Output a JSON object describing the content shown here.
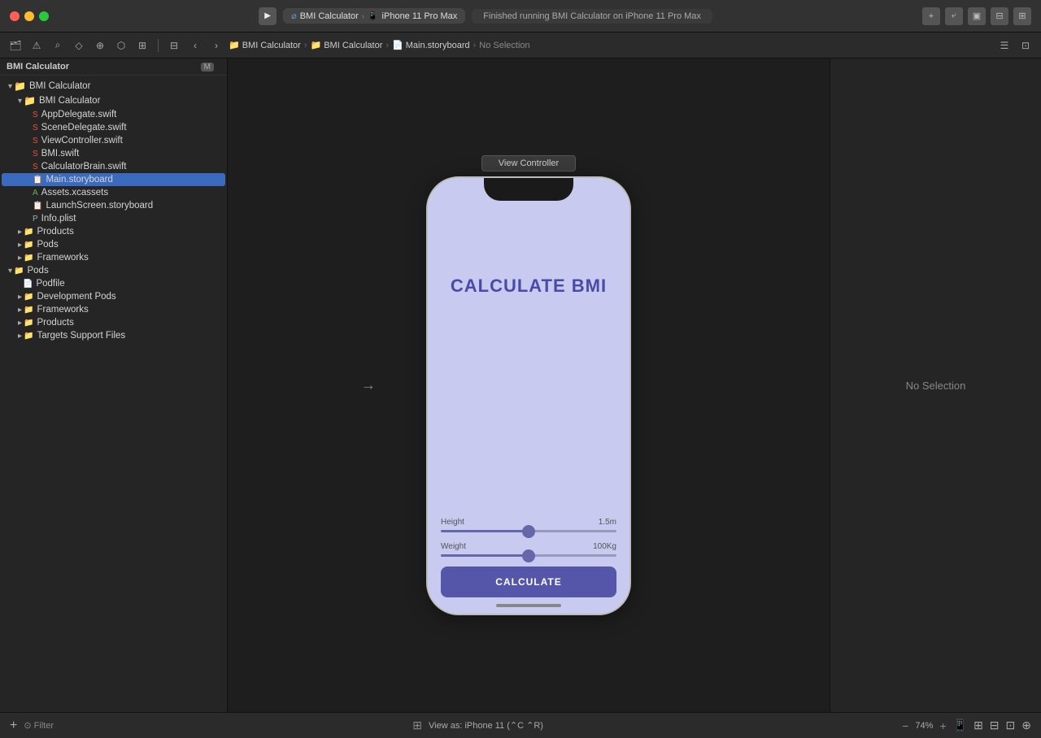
{
  "titleBar": {
    "schemeName": "BMI Calculator",
    "deviceName": "iPhone 11 Pro Max",
    "statusMessage": "Finished running BMI Calculator on iPhone 11 Pro Max",
    "addButtonLabel": "+",
    "icons": [
      "plus-icon",
      "arrow-icon",
      "layout-icon",
      "split-icon",
      "panel-icon"
    ]
  },
  "toolbar": {
    "icons": [
      "folder-icon",
      "warning-icon",
      "search-icon",
      "issue-icon",
      "bookmark-icon",
      "breakpoint-icon",
      "build-icon",
      "grid-icon"
    ],
    "breadcrumb": [
      "BMI Calculator",
      "BMI Calculator",
      "Main.storyboard",
      "No Selection"
    ],
    "rightIcons": [
      "inspector-icon",
      "jump-icon"
    ]
  },
  "sidebar": {
    "header": {
      "projectName": "BMI Calculator",
      "badge": "M"
    },
    "items": [
      {
        "id": "bmi-calculator-group",
        "label": "BMI Calculator",
        "type": "folder",
        "indent": 1,
        "expanded": true
      },
      {
        "id": "bmi-calculator-subgroup",
        "label": "BMI Calculator",
        "type": "folder",
        "indent": 2,
        "expanded": true
      },
      {
        "id": "appdelegate",
        "label": "AppDelegate.swift",
        "type": "swift",
        "indent": 3
      },
      {
        "id": "scenedelegate",
        "label": "SceneDelegate.swift",
        "type": "swift",
        "indent": 3
      },
      {
        "id": "viewcontroller",
        "label": "ViewController.swift",
        "type": "swift",
        "indent": 3
      },
      {
        "id": "bmi",
        "label": "BMI.swift",
        "type": "swift",
        "indent": 3
      },
      {
        "id": "calculatorbrain",
        "label": "CalculatorBrain.swift",
        "type": "swift",
        "indent": 3
      },
      {
        "id": "mainstoryboard",
        "label": "Main.storyboard",
        "type": "storyboard",
        "indent": 3,
        "selected": true
      },
      {
        "id": "assets",
        "label": "Assets.xcassets",
        "type": "xcassets",
        "indent": 3
      },
      {
        "id": "launchscreen",
        "label": "LaunchScreen.storyboard",
        "type": "storyboard",
        "indent": 3
      },
      {
        "id": "infoplist",
        "label": "Info.plist",
        "type": "plist",
        "indent": 3
      },
      {
        "id": "products",
        "label": "Products",
        "type": "folder",
        "indent": 2
      },
      {
        "id": "pods",
        "label": "Pods",
        "type": "folder",
        "indent": 2
      },
      {
        "id": "frameworks",
        "label": "Frameworks",
        "type": "folder",
        "indent": 2
      },
      {
        "id": "pods-group",
        "label": "Pods",
        "type": "folder",
        "indent": 1,
        "expanded": true
      },
      {
        "id": "podfile",
        "label": "Podfile",
        "type": "file",
        "indent": 2
      },
      {
        "id": "devpods",
        "label": "Development Pods",
        "type": "folder",
        "indent": 2
      },
      {
        "id": "frameworks2",
        "label": "Frameworks",
        "type": "folder",
        "indent": 2
      },
      {
        "id": "products2",
        "label": "Products",
        "type": "folder",
        "indent": 2
      },
      {
        "id": "targetssupport",
        "label": "Targets Support Files",
        "type": "folder",
        "indent": 2
      }
    ]
  },
  "canvas": {
    "viewControllerLabel": "View Controller",
    "arrowSymbol": "→",
    "app": {
      "title": "CALCULATE BMI",
      "height": {
        "label": "Height",
        "value": "1.5m"
      },
      "weight": {
        "label": "Weight",
        "value": "100Kg"
      },
      "heightSliderPos": 50,
      "weightSliderPos": 50,
      "calculateButton": "CALCULATE"
    }
  },
  "inspector": {
    "noSelectionLabel": "No Selection"
  },
  "statusBar": {
    "addLabel": "+",
    "filterLabel": "Filter",
    "viewAsLabel": "View as: iPhone 11 (⌃C ⌃R)",
    "zoomOut": "−",
    "zoomLevel": "74%",
    "zoomIn": "+",
    "rightIcons": [
      "device-icon",
      "layout-icon",
      "fit-icon",
      "zoom-icon",
      "more-icon"
    ]
  }
}
